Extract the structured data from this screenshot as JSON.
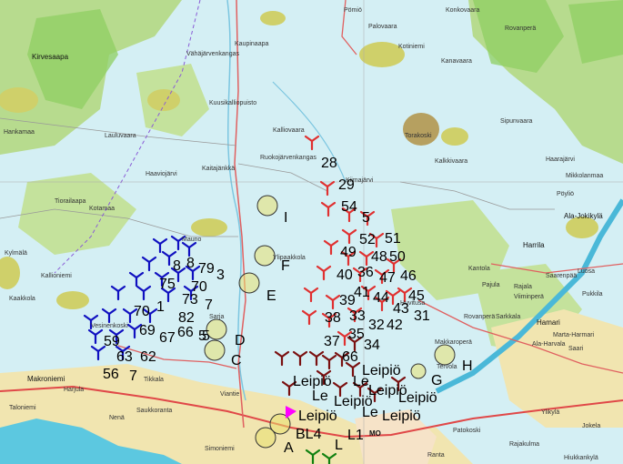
{
  "map": {
    "colors": {
      "water": "#c8ecf2",
      "lake": "#5cc8e0",
      "forest": "#b8d98c",
      "swamp": "#d7d66a",
      "field": "#f3e7b0",
      "road": "#e04040",
      "road_minor": "#888888",
      "turbine_red": "#e03030",
      "turbine_darkred": "#7a1010",
      "turbine_blue": "#1010c0",
      "turbine_green": "#108010",
      "marker_magenta": "#ff00ff",
      "circle_fill": "#e8e070"
    },
    "place_names": [
      "Kirvesaapa",
      "Pömiö",
      "Palovaara",
      "Konkovaara",
      "Kotiniemi",
      "Kanavaara",
      "Rovanperä",
      "Hankamaa",
      "Lauluvaara",
      "Vähäjärvenkangas",
      "Kaitajänkkä",
      "Kaupinaapa",
      "Kalliovaara",
      "Ruokojärvenkangas",
      "Haaviojärvi",
      "Kiimajärvi",
      "Tiorailaapa",
      "Kotamaa",
      "Torakoski",
      "Kalkkivaara",
      "Sipunvaara",
      "Haarajärvi",
      "Pöyliö",
      "Ala-Jokikylä",
      "Harrila",
      "Viiminperä",
      "Saarenpää",
      "Pukkila",
      "Hamari",
      "Kantola",
      "Luosa",
      "Tervola",
      "Pajula",
      "Sarkkala",
      "Rajala",
      "Ala-Harvala",
      "Makkaroperä",
      "Huvitusa",
      "Saari",
      "Marta-Harmari",
      "Rovanperä",
      "Mikkolanmaa",
      "Makroniemi",
      "Tikkala",
      "Taloniemi",
      "Harjula",
      "Nenä",
      "Saukkoranta",
      "Viantie",
      "Simoniemi",
      "Patokoski",
      "Rajakulma",
      "Ylikylä",
      "Jokela",
      "Ranta",
      "Hiukkankylä",
      "Kuusikalliopuisto",
      "Mauno",
      "Sarja",
      "Kylmälä",
      "Vesinenkoski",
      "Kaakkola",
      "Kallioniemi",
      "Ylipaakkola"
    ],
    "labels": {
      "turbines_red": [
        "28",
        "29",
        "54",
        "5",
        "52",
        "51",
        "49",
        "48",
        "50",
        "40",
        "36",
        "47",
        "46",
        "41",
        "44",
        "45",
        "39",
        "43",
        "38",
        "33",
        "32",
        "42",
        "31",
        "37",
        "35",
        "34"
      ],
      "turbines_blue": [
        "8",
        "79",
        "75",
        "70",
        "73",
        "7",
        "3",
        "70",
        "1",
        "82",
        "69",
        "67",
        "66",
        "5",
        "59",
        "63",
        "62",
        "56",
        "7",
        "8",
        "5"
      ],
      "sites": [
        "I",
        "F",
        "E",
        "D",
        "C",
        "G",
        "H",
        "A",
        "BL4",
        "L",
        "L1",
        "MO"
      ],
      "leipio": [
        "Leipiö",
        "Leipiö",
        "Leipiö",
        "Leipiö",
        "Leipiö",
        "Leipiö",
        "Leipiö",
        "Le",
        "Le",
        "Le"
      ],
      "dark_turbine_num": "66"
    }
  }
}
